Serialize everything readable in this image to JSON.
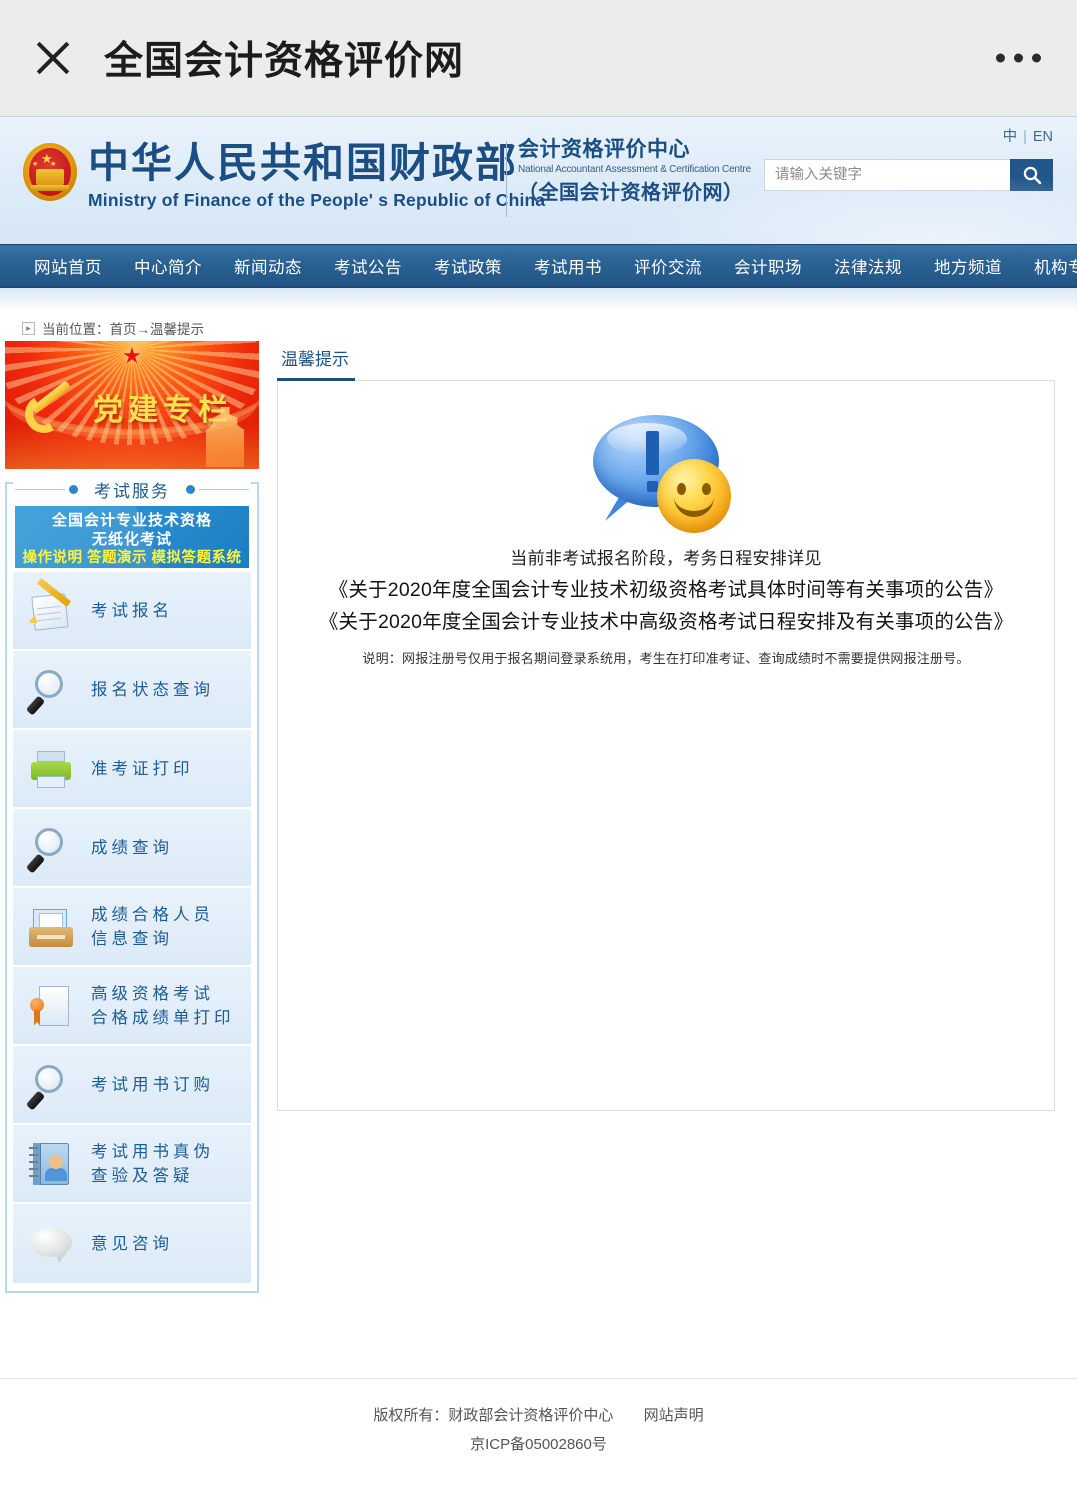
{
  "browser": {
    "title": "全国会计资格评价网",
    "close_icon": "close-icon",
    "menu_icon": "more-dots-icon"
  },
  "header": {
    "ministry_cn": "中华人民共和国财政部",
    "ministry_en": "Ministry of Finance of the People' s Republic of China",
    "center_cn": "会计资格评价中心",
    "center_en": "National Accountant Assessment & Certification Centre",
    "center_site": "（全国会计资格评价网）",
    "lang_cn": "中",
    "lang_sep": "|",
    "lang_en": "EN",
    "search_placeholder": "请输入关键字",
    "search_value": "",
    "search_icon": "search-icon"
  },
  "nav": {
    "items": [
      "网站首页",
      "中心简介",
      "新闻动态",
      "考试公告",
      "考试政策",
      "考试用书",
      "评价交流",
      "会计职场",
      "法律法规",
      "地方频道",
      "机构专区"
    ]
  },
  "breadcrumb": {
    "icon": "arrow-marker-icon",
    "text": "当前位置：首页→温馨提示"
  },
  "sidebar": {
    "party_banner": {
      "text": "党建专栏",
      "emblem_icon": "hammer-sickle-icon"
    },
    "service_title": "考试服务",
    "paperless_banner": {
      "line1": "全国会计专业技术资格",
      "line2": "无纸化考试",
      "line3": "操作说明 答题演示 模拟答题系统"
    },
    "items": [
      {
        "label": "考试报名",
        "icon": "notepad-pencil-icon"
      },
      {
        "label": "报名状态查询",
        "icon": "magnifier-icon"
      },
      {
        "label": "准考证打印",
        "icon": "printer-icon"
      },
      {
        "label": "成绩查询",
        "icon": "magnifier-icon"
      },
      {
        "label": "成绩合格人员\n信息查询",
        "icon": "inbox-tray-icon"
      },
      {
        "label": "高级资格考试\n合格成绩单打印",
        "icon": "certificate-seal-icon"
      },
      {
        "label": "考试用书订购",
        "icon": "magnifier-icon"
      },
      {
        "label": "考试用书真伪\n查验及答疑",
        "icon": "book-person-icon"
      },
      {
        "label": "意见咨询",
        "icon": "speech-bubble-icon"
      }
    ]
  },
  "main": {
    "tab_label": "温馨提示",
    "icon": "speech-bubble-exclamation-smiley-icon",
    "notice_intro": "当前非考试报名阶段，考务日程安排详见",
    "notice_link_1": "《关于2020年度全国会计专业技术初级资格考试具体时间等有关事项的公告》",
    "notice_link_2": "《关于2020年度全国会计专业技术中高级资格考试日程安排及有关事项的公告》",
    "notice_small": "说明：网报注册号仅用于报名期间登录系统用，考生在打印准考证、查询成绩时不需要提供网报注册号。"
  },
  "footer": {
    "copyright": "版权所有：财政部会计资格评价中心",
    "statement": "网站声明",
    "icp": "京ICP备05002860号"
  },
  "colors": {
    "nav_blue": "#2a6293",
    "brand_blue": "#1b4e82",
    "accent_link": "#1d5c96",
    "party_red": "#ef2a0c",
    "banner_blue": "#2a8fd0"
  }
}
